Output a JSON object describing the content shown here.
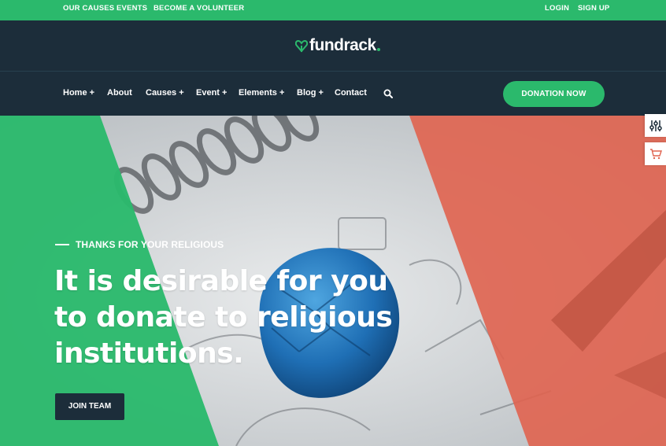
{
  "topbar": {
    "left_links": [
      "OUR CAUSES",
      "EVENTS",
      "BECOME A VOLUNTEER"
    ],
    "right_links": [
      "LOGIN",
      "SIGN UP"
    ]
  },
  "brand": {
    "name": "fundrack"
  },
  "nav": {
    "items": [
      "Home +",
      "About",
      "Causes +",
      "Event +",
      "Elements +",
      "Blog +",
      "Contact"
    ],
    "search_icon": "search-icon",
    "cta": "DONATION NOW"
  },
  "hero": {
    "eyebrow": "THANKS FOR YOUR RELIGIOUS",
    "headline_lines": [
      "It is desirable for you",
      "to donate to religious",
      "institutions."
    ],
    "button": "JOIN TEAM"
  },
  "side_widgets": [
    "settings-sliders-icon",
    "shopping-cart-icon"
  ],
  "colors": {
    "green": "#2bb96c",
    "navy": "#1c2d3a",
    "coral": "#e0634f"
  }
}
